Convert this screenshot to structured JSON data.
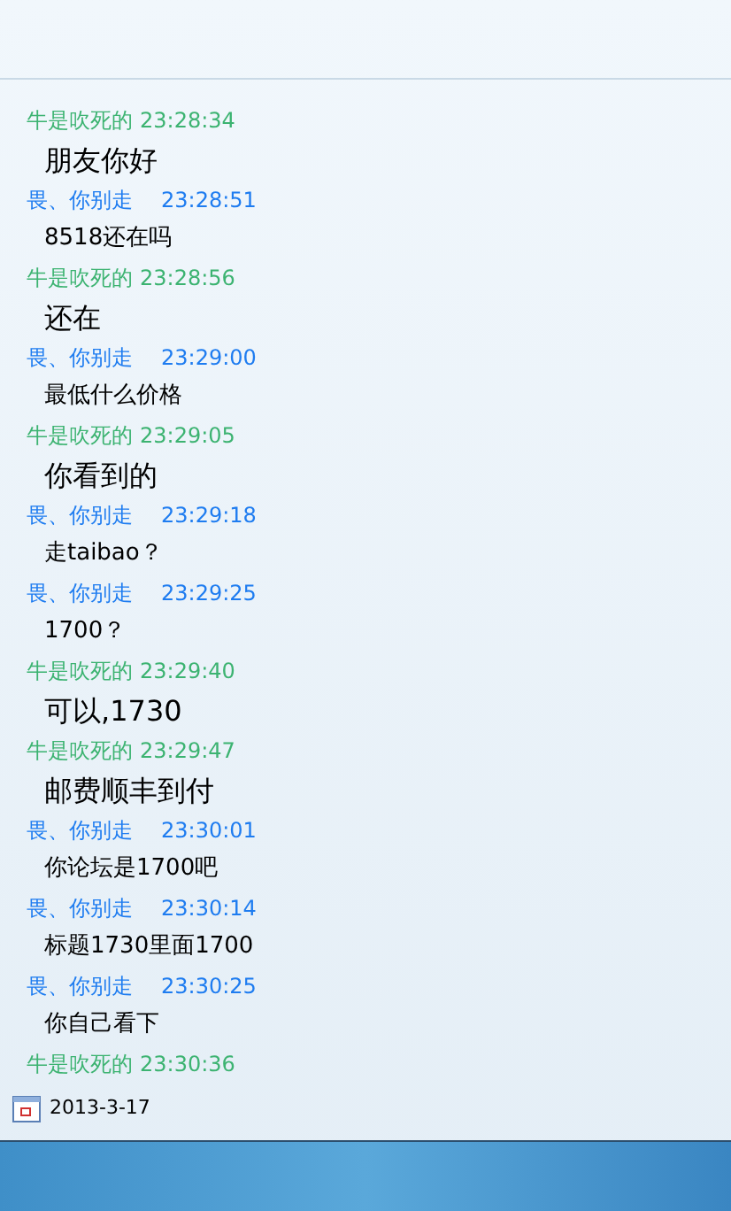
{
  "messages": [
    {
      "kind": "other",
      "sender": "牛是吹死的",
      "time": "23:28:34",
      "text": "朋友你好"
    },
    {
      "kind": "me",
      "sender": "畏、你别走",
      "time": "23:28:51",
      "text": "8518还在吗"
    },
    {
      "kind": "other",
      "sender": "牛是吹死的",
      "time": "23:28:56",
      "text": "还在"
    },
    {
      "kind": "me",
      "sender": "畏、你别走",
      "time": "23:29:00",
      "text": "最低什么价格"
    },
    {
      "kind": "other",
      "sender": "牛是吹死的",
      "time": "23:29:05",
      "text": "你看到的"
    },
    {
      "kind": "me",
      "sender": "畏、你别走",
      "time": "23:29:18",
      "text": "走taibao？"
    },
    {
      "kind": "me",
      "sender": "畏、你别走",
      "time": "23:29:25",
      "text": "1700？"
    },
    {
      "kind": "other",
      "sender": "牛是吹死的",
      "time": "23:29:40",
      "text": "可以,1730"
    },
    {
      "kind": "other",
      "sender": "牛是吹死的",
      "time": "23:29:47",
      "text": "邮费顺丰到付"
    },
    {
      "kind": "me",
      "sender": "畏、你别走",
      "time": "23:30:01",
      "text": "你论坛是1700吧"
    },
    {
      "kind": "me",
      "sender": "畏、你别走",
      "time": "23:30:14",
      "text": "标题1730里面1700"
    },
    {
      "kind": "me",
      "sender": "畏、你别走",
      "time": "23:30:25",
      "text": "你自己看下"
    },
    {
      "kind": "other",
      "sender": "牛是吹死的",
      "time": "23:30:36"
    }
  ],
  "date": "2013-3-17"
}
